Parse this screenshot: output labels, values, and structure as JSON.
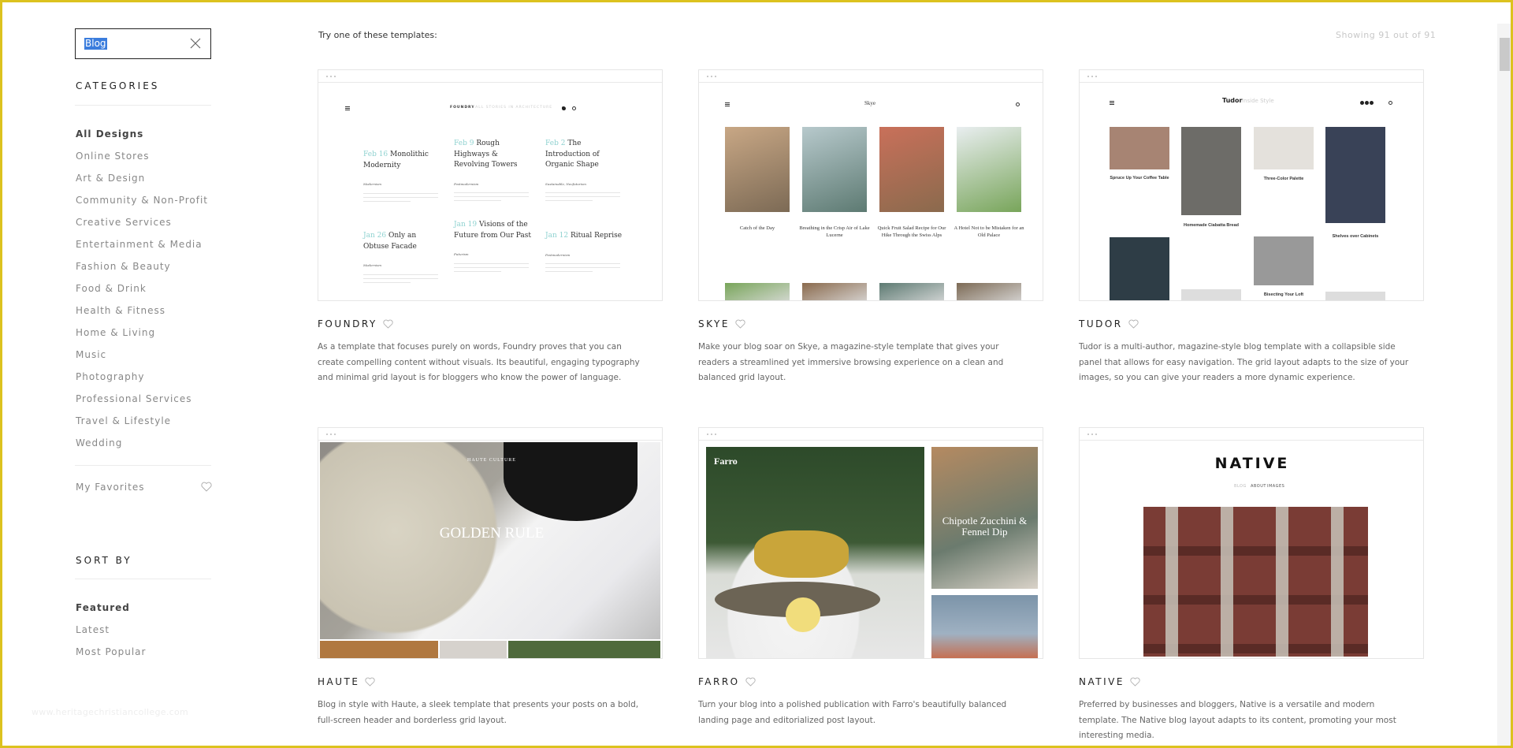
{
  "search": {
    "value": "Blog"
  },
  "sidebar": {
    "categories_heading": "CATEGORIES",
    "categories": [
      "All Designs",
      "Online Stores",
      "Art & Design",
      "Community & Non-Profit",
      "Creative Services",
      "Entertainment & Media",
      "Fashion & Beauty",
      "Food & Drink",
      "Health & Fitness",
      "Home & Living",
      "Music",
      "Photography",
      "Professional Services",
      "Travel & Lifestyle",
      "Wedding"
    ],
    "active_category": "All Designs",
    "favorites": "My Favorites",
    "sort_heading": "SORT BY",
    "sort_options": [
      "Featured",
      "Latest",
      "Most Popular"
    ],
    "active_sort": "Featured"
  },
  "watermark": "www.heritagechristiancollege.com",
  "main": {
    "intro": "Try one of these templates:",
    "count": "Showing 91 out of 91"
  },
  "colors": {
    "accent_border": "#dcc21f",
    "selection": "#3b7ddd",
    "foundry_date": "#8fd2d0"
  },
  "templates": [
    {
      "name": "FOUNDRY",
      "description": "As a template that focuses purely on words, Foundry proves that you can create compelling content without visuals. Its beautiful, engaging typography and minimal grid layout is for bloggers who know the power of language.",
      "preview": {
        "brand": "FOUNDRY",
        "tagline": "FALL STORIES IN ARCHITECTURE",
        "posts": [
          {
            "date": "Feb 16",
            "title": "Monolithic Modernity",
            "tag": "Modernism"
          },
          {
            "date": "Feb 9",
            "title": "Rough Highways & Revolving Towers",
            "tag": "Postmodernism"
          },
          {
            "date": "Feb 2",
            "title": "The Introduction of Organic Shape",
            "tag": "Sustainable, Neofuturism"
          },
          {
            "date": "Jan 26",
            "title": "Only an Obtuse Facade",
            "tag": "Modernism"
          },
          {
            "date": "Jan 19",
            "title": "Visions of the Future from Our Past",
            "tag": "Futurism"
          },
          {
            "date": "Jan 12",
            "title": "Ritual Reprise",
            "tag": "Postmodernism"
          }
        ]
      }
    },
    {
      "name": "SKYE",
      "description": "Make your blog soar on Skye, a magazine-style template that gives your readers a streamlined yet immersive browsing experience on a clean and balanced grid layout.",
      "preview": {
        "brand": "Skye",
        "posts": [
          "Catch of the Day",
          "Breathing in the Crisp Air of Lake Lucerne",
          "Quick Fruit Salad Recipe for Our Hike Through the Swiss Alps",
          "A Hotel Not to be Mistaken for an Old Palace"
        ]
      }
    },
    {
      "name": "TUDOR",
      "description": "Tudor is a multi-author, magazine-style blog template with a collapsible side panel that allows for easy navigation. The grid layout adapts to the size of your images, so you can give your readers a more dynamic experience.",
      "preview": {
        "brand": "Tudor",
        "tagline": "Inside Style",
        "posts": [
          "Spruce Up Your Coffee Table",
          "Homemade Ciabatta Bread",
          "Three-Color Palette",
          "Shelves over Cabinets",
          "Bisecting Your Loft"
        ]
      }
    },
    {
      "name": "HAUTE",
      "description": "Blog in style with Haute, a sleek template that presents your posts on a bold, full-screen header and borderless grid layout.",
      "preview": {
        "brand": "HAUTE CULTURE",
        "headline": "GOLDEN RULE"
      }
    },
    {
      "name": "FARRO",
      "description": "Turn your blog into a polished publication with Farro's beautifully balanced landing page and editorialized post layout.",
      "preview": {
        "brand": "Farro",
        "headline": "Chipotle Zucchini & Fennel Dip"
      }
    },
    {
      "name": "NATIVE",
      "description": "Preferred by businesses and bloggers, Native is a versatile and modern template. The Native blog layout adapts to its content, promoting your most interesting media.",
      "preview": {
        "brand": "NATIVE",
        "nav": [
          "BLOG",
          "ABOUT",
          "IMAGES"
        ]
      }
    }
  ]
}
